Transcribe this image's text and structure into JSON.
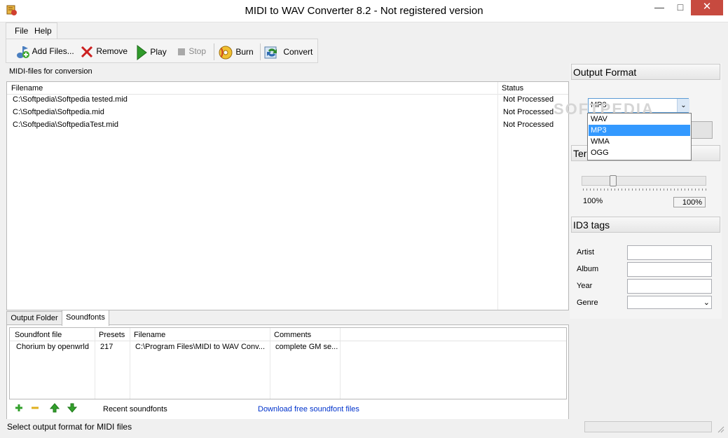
{
  "window": {
    "title": "MIDI to WAV Converter 8.2 - Not registered version"
  },
  "menu": {
    "items": [
      "File",
      "Help"
    ]
  },
  "toolbar": {
    "add_files": "Add Files...",
    "remove": "Remove",
    "play": "Play",
    "stop": "Stop",
    "burn": "Burn",
    "convert": "Convert"
  },
  "files": {
    "label": "MIDI-files for conversion",
    "columns": [
      "Filename",
      "Status"
    ],
    "rows": [
      {
        "filename": "C:\\Softpedia\\Softpedia tested.mid",
        "status": "Not Processed"
      },
      {
        "filename": "C:\\Softpedia\\Softpedia.mid",
        "status": "Not Processed"
      },
      {
        "filename": "C:\\Softpedia\\SoftpediaTest.mid",
        "status": "Not Processed"
      }
    ]
  },
  "tabs": [
    "Output Folder",
    "Soundfonts"
  ],
  "soundfonts": {
    "columns": [
      "Soundfont file",
      "Presets",
      "Filename",
      "Comments"
    ],
    "rows": [
      {
        "file": "Chorium by openwrld",
        "presets": "217",
        "filename": "C:\\Program Files\\MIDI to WAV Conv...",
        "comments": "complete GM se..."
      }
    ],
    "recent_label": "Recent soundfonts",
    "download_link": "Download free soundfont files"
  },
  "status_text": "Select output format for MIDI files",
  "output_format": {
    "header": "Output Format",
    "selected": "MP3",
    "options": [
      "WAV",
      "MP3",
      "WMA",
      "OGG"
    ]
  },
  "tempo": {
    "header_visible_text": "Ter",
    "value_label": "100%",
    "box_value": "100%",
    "level_percent": 100
  },
  "id3": {
    "header": "ID3 tags",
    "fields": [
      "Artist",
      "Album",
      "Year",
      "Genre"
    ]
  },
  "watermark": "SOFTPEDIA",
  "colors": {
    "accent": "#3399ff",
    "link": "#0033cc",
    "close": "#c74a3f"
  }
}
